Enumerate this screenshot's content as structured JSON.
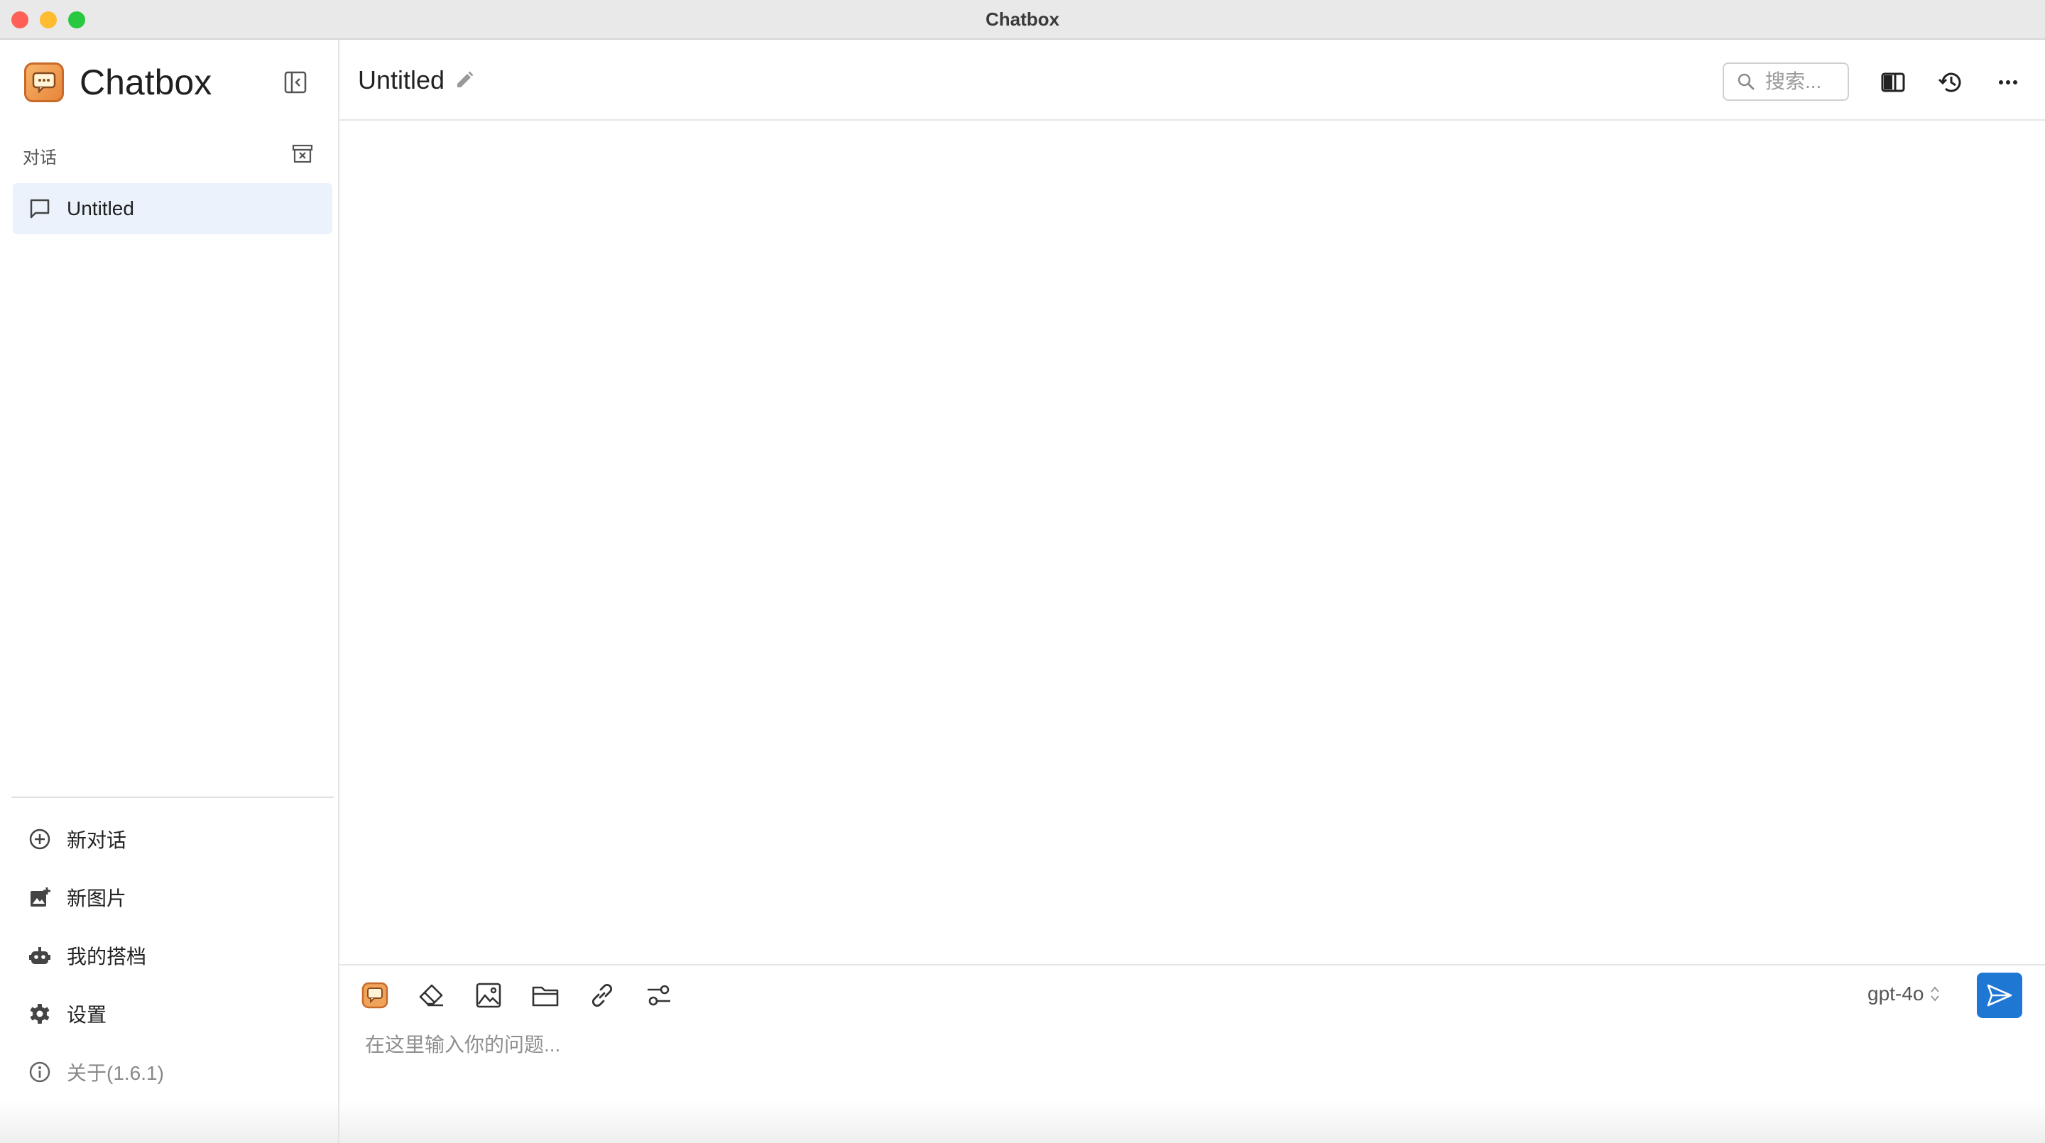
{
  "window": {
    "title": "Chatbox",
    "traffic_lights": [
      "close",
      "minimize",
      "maximize"
    ]
  },
  "sidebar": {
    "app_name": "Chatbox",
    "section_label": "对话",
    "sessions": [
      {
        "label": "Untitled",
        "icon": "chat-bubble-icon",
        "selected": true
      }
    ],
    "nav_items": [
      {
        "label": "新对话",
        "icon": "plus-circle-icon"
      },
      {
        "label": "新图片",
        "icon": "add-image-icon"
      },
      {
        "label": "我的搭档",
        "icon": "robot-icon"
      },
      {
        "label": "设置",
        "icon": "gear-icon"
      },
      {
        "label": "关于(1.6.1)",
        "icon": "info-icon"
      }
    ]
  },
  "header": {
    "title": "Untitled",
    "search_placeholder": "搜索..."
  },
  "composer": {
    "tools": [
      "chatbox-icon",
      "eraser-icon",
      "image-icon",
      "folder-icon",
      "link-icon",
      "settings-sliders-icon"
    ],
    "model": "gpt-4o",
    "placeholder": "在这里输入你的问题..."
  },
  "colors": {
    "accent": "#1f77d4",
    "selected_bg": "#ebf2fb",
    "titlebar": "#e9e9e9"
  }
}
